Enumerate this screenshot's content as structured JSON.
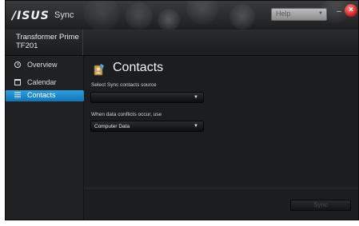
{
  "window": {
    "logo_text": "/ISUS",
    "app_name": "Sync",
    "help": {
      "value": "Help"
    },
    "minimize_glyph": "–",
    "close_glyph": "×"
  },
  "device": {
    "line1": "Transformer Prime",
    "line2": "TF201"
  },
  "sidebar": {
    "items": [
      {
        "label": "Overview",
        "icon": "info-icon",
        "active": false
      },
      {
        "label": "Calendar",
        "icon": "calendar-icon",
        "active": false
      },
      {
        "label": "Contacts",
        "icon": "contacts-list-icon",
        "active": true
      }
    ]
  },
  "main": {
    "title": "Contacts",
    "source": {
      "label": "Select Sync contacts source",
      "value": ""
    },
    "conflict": {
      "label": "When data conflicts occur, use",
      "value": "Computer Data"
    },
    "sync_button": "Sync"
  },
  "colors": {
    "accent": "#1a8bd0",
    "window_bg": "#1f2022",
    "close": "#d42020"
  }
}
